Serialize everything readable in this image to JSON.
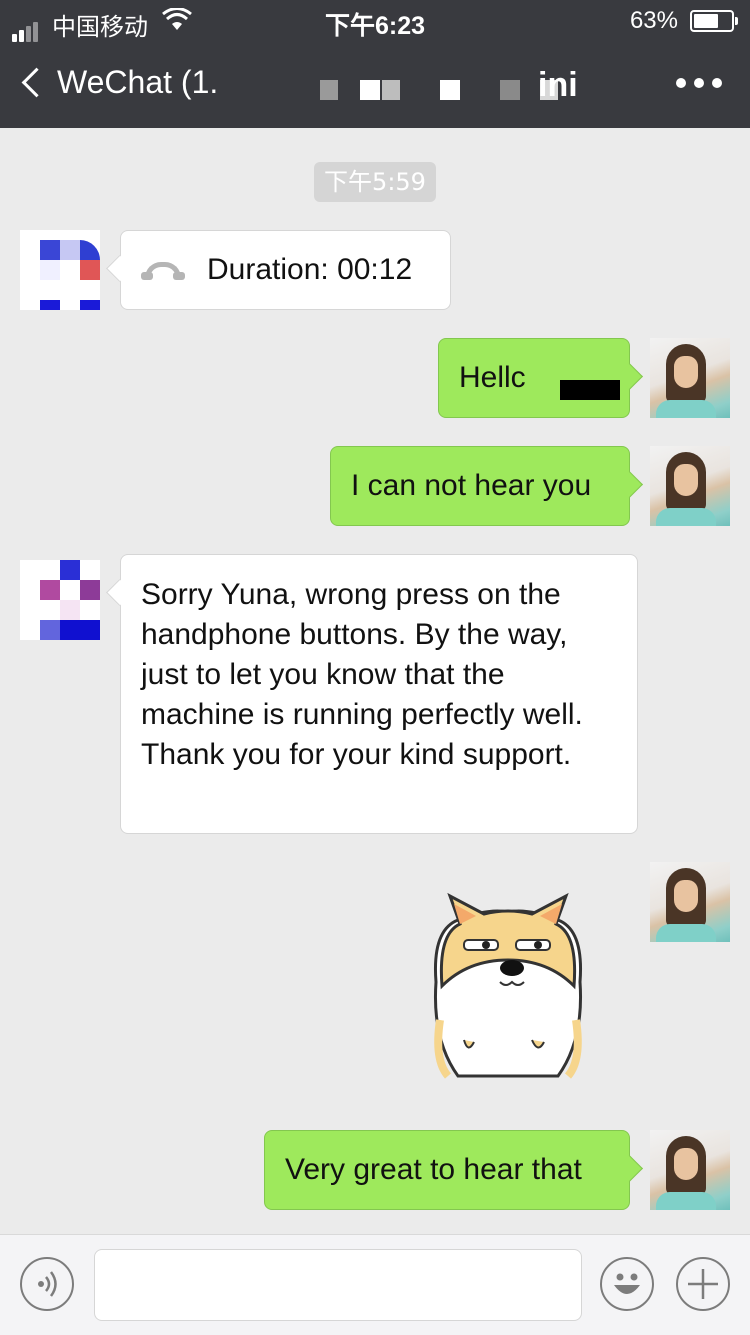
{
  "status_bar": {
    "carrier": "中国移动",
    "time": "下午6:23",
    "battery": "63%",
    "battery_level": 0.63,
    "icons": [
      "signal-icon",
      "wifi-icon",
      "battery-icon"
    ]
  },
  "nav": {
    "back_label": "WeChat (1.",
    "title_visible_fragment": "ini",
    "icons": [
      "back-chevron-icon",
      "more-icon"
    ]
  },
  "chat": {
    "timestamp": "下午5:59",
    "messages": [
      {
        "from": "contact",
        "type": "call",
        "text": "Duration: 00:12",
        "icon": "phone-hangup-icon"
      },
      {
        "from": "me",
        "type": "text",
        "text": "Hellc"
      },
      {
        "from": "me",
        "type": "text",
        "text": "I can not hear you"
      },
      {
        "from": "contact",
        "type": "text",
        "text": "Sorry Yuna, wrong press on the handphone buttons. By the way, just to let you know that the machine is running perfectly well. Thank you for your kind support."
      },
      {
        "from": "me",
        "type": "sticker",
        "sticker": "shiba-dog-sticker"
      },
      {
        "from": "me",
        "type": "text",
        "text": "Very great to hear that"
      }
    ]
  },
  "input_bar": {
    "value": "",
    "icons": [
      "voice-icon",
      "emoji-icon",
      "plus-icon"
    ]
  },
  "colors": {
    "header": "#393a3f",
    "background": "#ebebeb",
    "outgoing_bubble": "#9ee95c",
    "incoming_bubble": "#ffffff",
    "timestamp_bg": "#d5d5d5"
  }
}
